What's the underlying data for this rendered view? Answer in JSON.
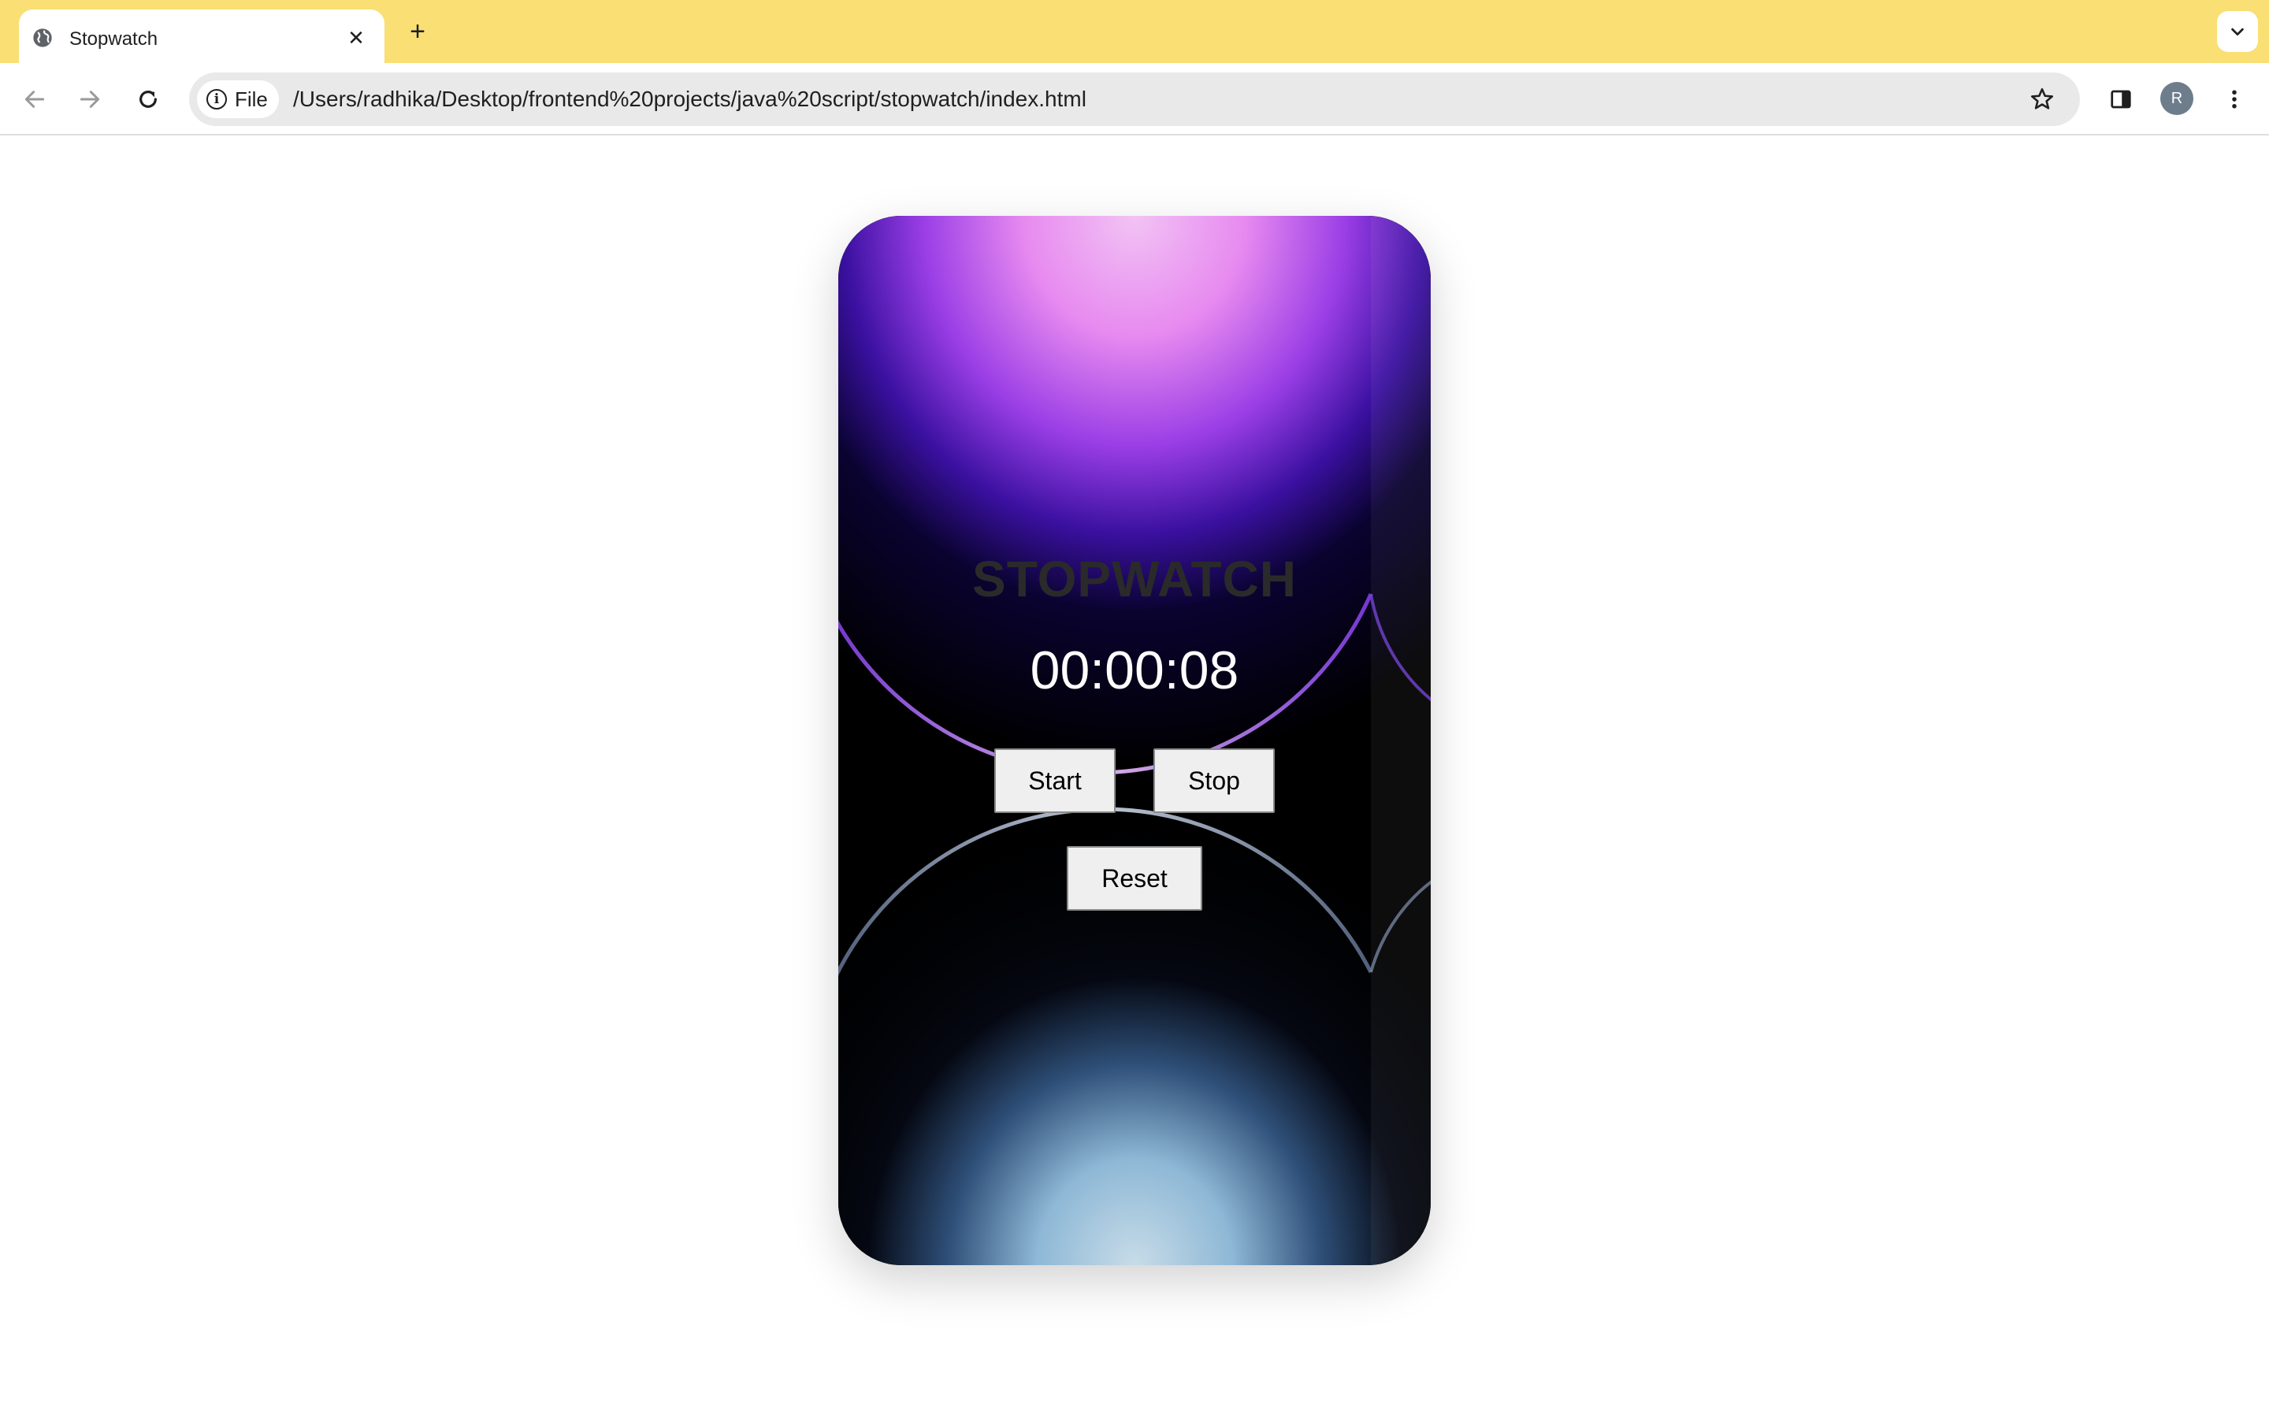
{
  "browser": {
    "tab_title": "Stopwatch",
    "url": "/Users/radhika/Desktop/frontend%20projects/java%20script/stopwatch/index.html",
    "security_chip_label": "File",
    "profile_initial": "R"
  },
  "stopwatch": {
    "title": "STOPWATCH",
    "time": "00:00:08",
    "start_label": "Start",
    "stop_label": "Stop",
    "reset_label": "Reset"
  },
  "colors": {
    "tabbar": "#f9df74",
    "accent_purple": "#c24af0",
    "accent_blue": "#9fc4dc"
  }
}
